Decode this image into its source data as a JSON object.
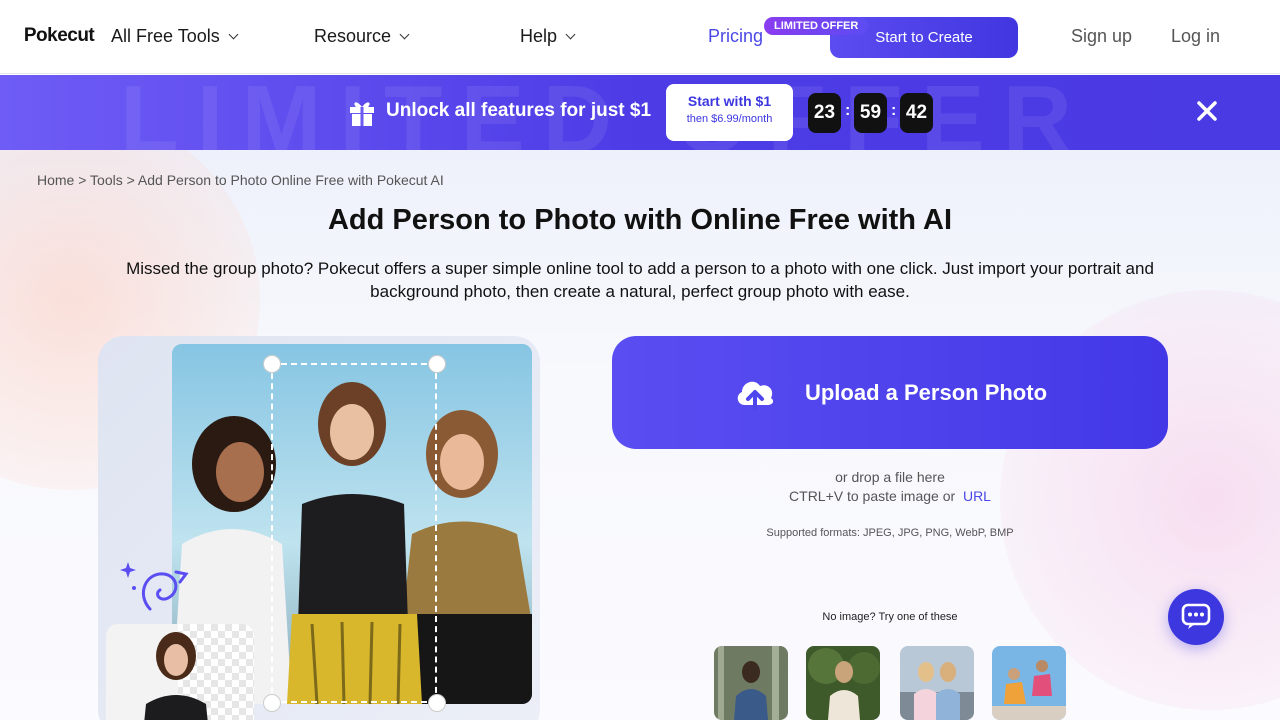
{
  "nav": {
    "logo": "Pokecut",
    "items": [
      {
        "label": "All Free Tools"
      },
      {
        "label": "Resource"
      },
      {
        "label": "Help"
      }
    ],
    "pricing": "Pricing",
    "limited_badge": "LIMITED OFFER",
    "start_button": "Start to Create",
    "signup": "Sign up",
    "login": "Log in"
  },
  "promo": {
    "background_text": "LIMITED OFFER",
    "text": "Unlock all features for just $1",
    "button_main": "Start with $1",
    "button_sub": "then $6.99/month",
    "timer": {
      "hours": "23",
      "minutes": "59",
      "seconds": "42"
    },
    "colors": {
      "accent": "#4d3ce6"
    }
  },
  "breadcrumb": "Home > Tools > Add Person to Photo Online Free with Pokecut AI",
  "page": {
    "title": "Add Person to Photo with Online Free with AI",
    "description": "Missed the group photo? Pokecut offers a super simple online tool to add a person to a photo with one click. Just import your portrait and background photo, then create a natural, perfect group photo with ease."
  },
  "upload": {
    "button_label": "Upload a Person Photo",
    "drop_text": "or drop a file here",
    "paste_text": "CTRL+V to paste image or",
    "url_label": "URL",
    "formats": "Supported formats: JPEG, JPG, PNG, WebP, BMP",
    "try_text": "No image? Try one of these"
  },
  "icons": {
    "gift": "gift-icon",
    "close": "close-icon",
    "upload": "cloud-upload-icon",
    "chat": "chat-icon"
  }
}
